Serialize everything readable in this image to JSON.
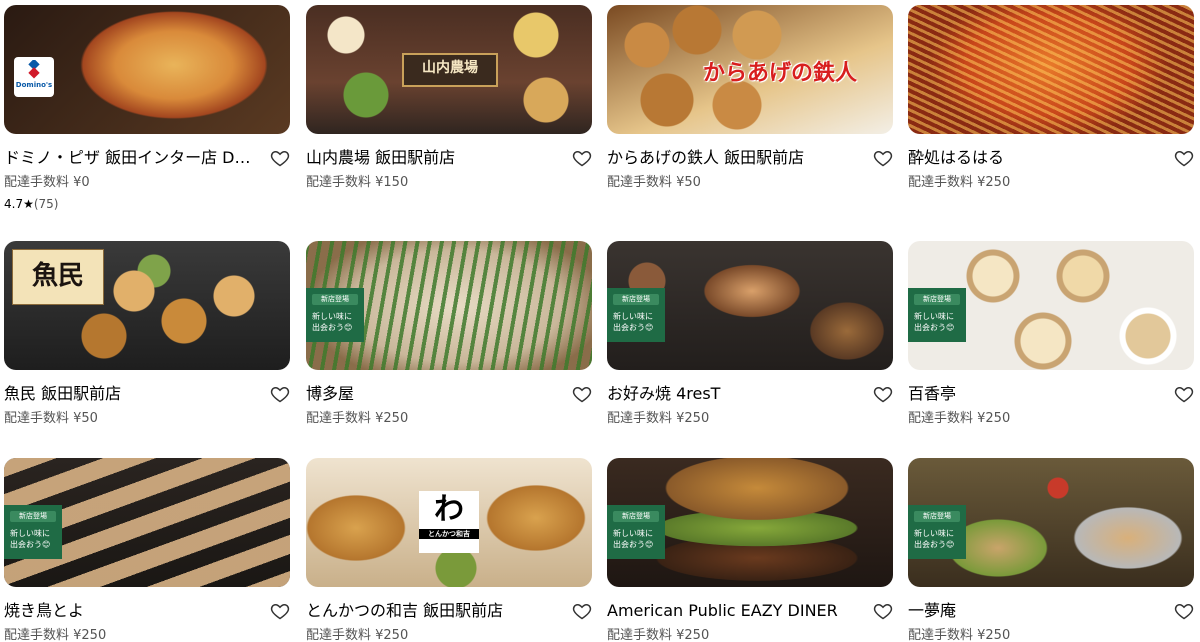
{
  "restaurants": [
    {
      "name": "ドミノ・ピザ 飯田インター店 Domin…",
      "fee": "配達手数料 ¥0",
      "rating_value": "4.7",
      "rating_star": "★",
      "rating_count": "(75)",
      "logo_text": "Domino's",
      "image_colors": [
        "#3b2418",
        "#c66a2c",
        "#e9b45a",
        "#7a3b1f"
      ]
    },
    {
      "name": "山内農場 飯田駅前店",
      "fee": "配達手数料 ¥150",
      "logo_text": "山内農場",
      "image_colors": [
        "#5c3a26",
        "#d6a55a",
        "#88a04a",
        "#2e2a2a"
      ]
    },
    {
      "name": "からあげの鉄人 飯田駅前店",
      "fee": "配達手数料 ¥50",
      "logo_text": "からあげの鉄人",
      "image_colors": [
        "#8a5426",
        "#c98a44",
        "#e8c07a",
        "#f3efe6"
      ]
    },
    {
      "name": "酔処はるはる",
      "fee": "配達手数料 ¥250",
      "image_colors": [
        "#b53a14",
        "#e06a24",
        "#f0a04a",
        "#d9c7a8"
      ]
    },
    {
      "name": "魚民 飯田駅前店",
      "fee": "配達手数料 ¥50",
      "logo_text": "魚民",
      "image_colors": [
        "#2d2d2d",
        "#b5772f",
        "#e1b06a",
        "#7fa34a"
      ]
    },
    {
      "name": "博多屋",
      "fee": "配達手数料 ¥250",
      "badge": {
        "top": "新店登場",
        "body": "新しい味に\n出会おう😊"
      },
      "image_colors": [
        "#c9b79a",
        "#3f7a2c",
        "#e7dcc4",
        "#8a6d4a"
      ]
    },
    {
      "name": "お好み焼 4resT",
      "fee": "配達手数料 ¥250",
      "badge": {
        "top": "新店登場",
        "body": "新しい味に\n出会おう😊"
      },
      "image_colors": [
        "#2a2623",
        "#7a4a2a",
        "#c98a4a",
        "#5a3a24"
      ]
    },
    {
      "name": "百香亭",
      "fee": "配達手数料 ¥250",
      "badge": {
        "top": "新店登場",
        "body": "新しい味に\n出会おう😊"
      },
      "image_colors": [
        "#f1eee8",
        "#e2c89a",
        "#c9a472",
        "#ffffff"
      ]
    },
    {
      "name": "焼き鳥とよ",
      "fee": "配達手数料 ¥250",
      "badge": {
        "top": "新店登場",
        "body": "新しい味に\n出会おう😊"
      },
      "image_colors": [
        "#1f1b18",
        "#d7b184",
        "#b4865a",
        "#3a2e24"
      ]
    },
    {
      "name": "とんかつの和吉 飯田駅前店",
      "fee": "配達手数料 ¥250",
      "logo_text": "わ",
      "logo_sub": "とんかつ和吉",
      "image_colors": [
        "#b5762e",
        "#d9a24e",
        "#7a9a3a",
        "#efe3cf"
      ]
    },
    {
      "name": "American Public EAZY DINER",
      "fee": "配達手数料 ¥250",
      "badge": {
        "top": "新店登場",
        "body": "新しい味に\n出会おう😊"
      },
      "image_colors": [
        "#6a3a1e",
        "#c58a3a",
        "#86a83a",
        "#2a1e18"
      ]
    },
    {
      "name": "一夢庵",
      "fee": "配達手数料 ¥250",
      "badge": {
        "top": "新店登場",
        "body": "新しい味に\n出会おう😊"
      },
      "image_colors": [
        "#5a4a2a",
        "#c9a46a",
        "#b8b8b8",
        "#7a9a3a"
      ]
    }
  ],
  "icons": {
    "favorite": "heart-outline-icon"
  },
  "colors": {
    "badge_green": "#1f6b45",
    "fee_gray": "#545454"
  }
}
